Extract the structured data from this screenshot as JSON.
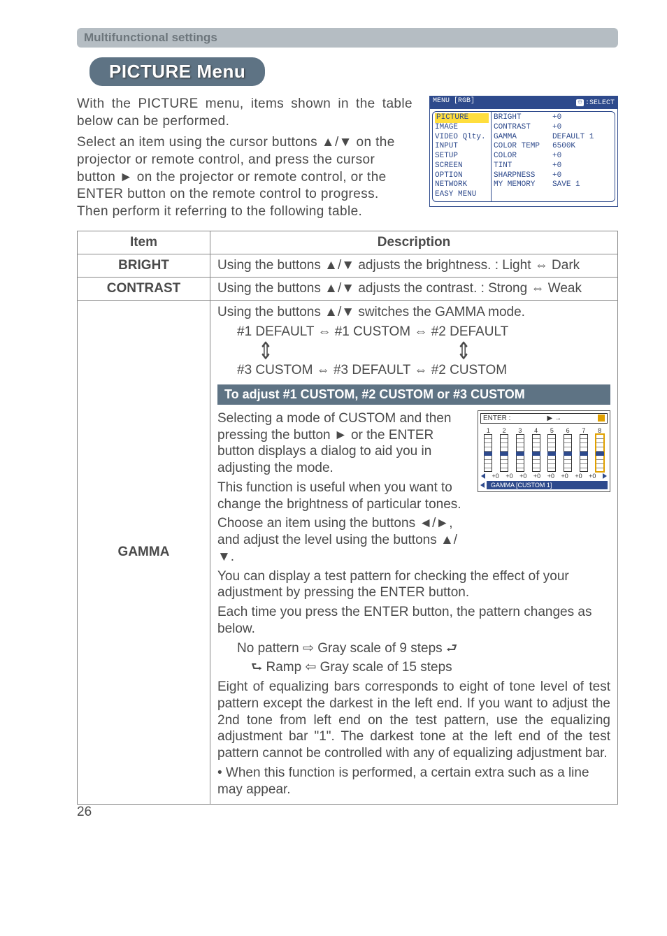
{
  "section_header": "Multifunctional settings",
  "menu_title": "PICTURE Menu",
  "intro": {
    "p1": "With the PICTURE menu, items shown in the table below can be performed.",
    "p2": "Select an item using the cursor buttons ▲/▼ on the projector or remote control, and press the cursor button ► on the projector or remote control, or the ENTER button on the remote control to progress. Then perform it referring to the following table."
  },
  "osd": {
    "header_left": "MENU [RGB]",
    "header_right": ":SELECT",
    "left_items": [
      "PICTURE",
      "IMAGE",
      "VIDEO Qlty.",
      "INPUT",
      "SETUP",
      "SCREEN",
      "OPTION",
      "NETWORK",
      "EASY MENU"
    ],
    "right_labels": [
      "BRIGHT",
      "CONTRAST",
      "GAMMA",
      "COLOR TEMP",
      "COLOR",
      "TINT",
      "SHARPNESS",
      "MY MEMORY"
    ],
    "right_values": [
      "+0",
      "+0",
      "DEFAULT 1",
      "6500K",
      "+0",
      "+0",
      "+0",
      "SAVE 1"
    ]
  },
  "table": {
    "col_item": "Item",
    "col_desc": "Description",
    "rows": {
      "bright": {
        "name": "BRIGHT",
        "desc": "Using the buttons ▲/▼ adjusts the brightness. :    Light ⇔ Dark"
      },
      "contrast": {
        "name": "CONTRAST",
        "desc": "Using the buttons ▲/▼ adjusts the contrast. :    Strong ⇔ Weak"
      },
      "gamma": {
        "name": "GAMMA",
        "top1": "Using the buttons ▲/▼ switches the GAMMA mode.",
        "chain1": "#1 DEFAULT ⇔ #1 CUSTOM ⇔ #2 DEFAULT",
        "chain2": "#3 CUSTOM ⇔ #3 DEFAULT ⇔ #2 CUSTOM",
        "sub_header": "To adjust #1 CUSTOM, #2 CUSTOM or #3 CUSTOM",
        "p_select": "Selecting a mode of CUSTOM and then pressing the button ► or the ENTER button displays a dialog to aid you in adjusting the mode.",
        "p_useful": "This function is useful when you want to change the brightness of particular tones.",
        "p_choose": "Choose an item using the buttons ◄/►, and adjust the level using the buttons ▲/▼.",
        "p_testpat": "You can display a test pattern for checking the effect of your adjustment by pressing the ENTER button.",
        "p_each": "Each time you press the ENTER button, the pattern changes as below.",
        "seq1": "No pattern ⇨ Gray scale of 9 steps ",
        "seq2": "Ramp ⇦ Gray scale of 15 steps",
        "p_eight": "Eight of equalizing bars corresponds to eight of tone level of test pattern except the darkest in the left end. If you want to adjust the 2nd tone from left end on the test pattern, use the equalizing adjustment bar \"1\". The darkest tone at the left end of the test pattern cannot be controlled with any of equalizing adjustment bar.",
        "p_when": "• When this function is performed, a certain extra such as a line may appear."
      }
    }
  },
  "eq": {
    "enter": "ENTER :",
    "nums": [
      "1",
      "2",
      "3",
      "4",
      "5",
      "6",
      "7",
      "8"
    ],
    "vals": [
      "+0",
      "+0",
      "+0",
      "+0",
      "+0",
      "+0",
      "+0",
      "+0"
    ],
    "tag": "GAMMA [CUSTOM 1]"
  },
  "page_number": "26"
}
